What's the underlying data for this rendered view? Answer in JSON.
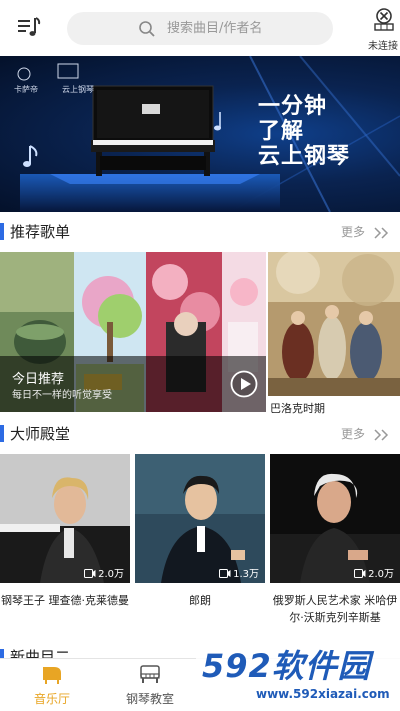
{
  "header": {
    "search_placeholder": "搜索曲目/作者名",
    "connection_label": "未连接"
  },
  "banner": {
    "slogan_lines": [
      "一分钟",
      "了解",
      "云上钢琴"
    ],
    "logo_left": "卡萨帝",
    "logo_right": "云上钢琴"
  },
  "sections": {
    "recommended": {
      "title": "推荐歌单",
      "more": "更多"
    },
    "masters": {
      "title": "大师殿堂",
      "more": "更多"
    },
    "next_partial": {
      "title": "新曲目二"
    }
  },
  "recommend": {
    "today_title": "今日推荐",
    "today_subtitle": "每日不一样的听觉享受",
    "baroque_label": "巴洛克时期"
  },
  "masters": [
    {
      "views": "2.0万",
      "name": "钢琴王子 理查德·克莱德曼"
    },
    {
      "views": "1.3万",
      "name": "郎朗"
    },
    {
      "views": "2.0万",
      "name": "俄罗斯人民艺术家 米哈伊尔·沃斯克列辛斯基"
    }
  ],
  "tabs": [
    {
      "label": "音乐厅",
      "active": true
    },
    {
      "label": "钢琴教室",
      "active": false
    }
  ],
  "watermark": {
    "big": "592软件园",
    "small": "www.592xiazai.com"
  },
  "colors": {
    "accent": "#2d6be3",
    "tab_active": "#e8a524",
    "tab_inactive": "#555555",
    "watermark": "#1f5bb8"
  }
}
